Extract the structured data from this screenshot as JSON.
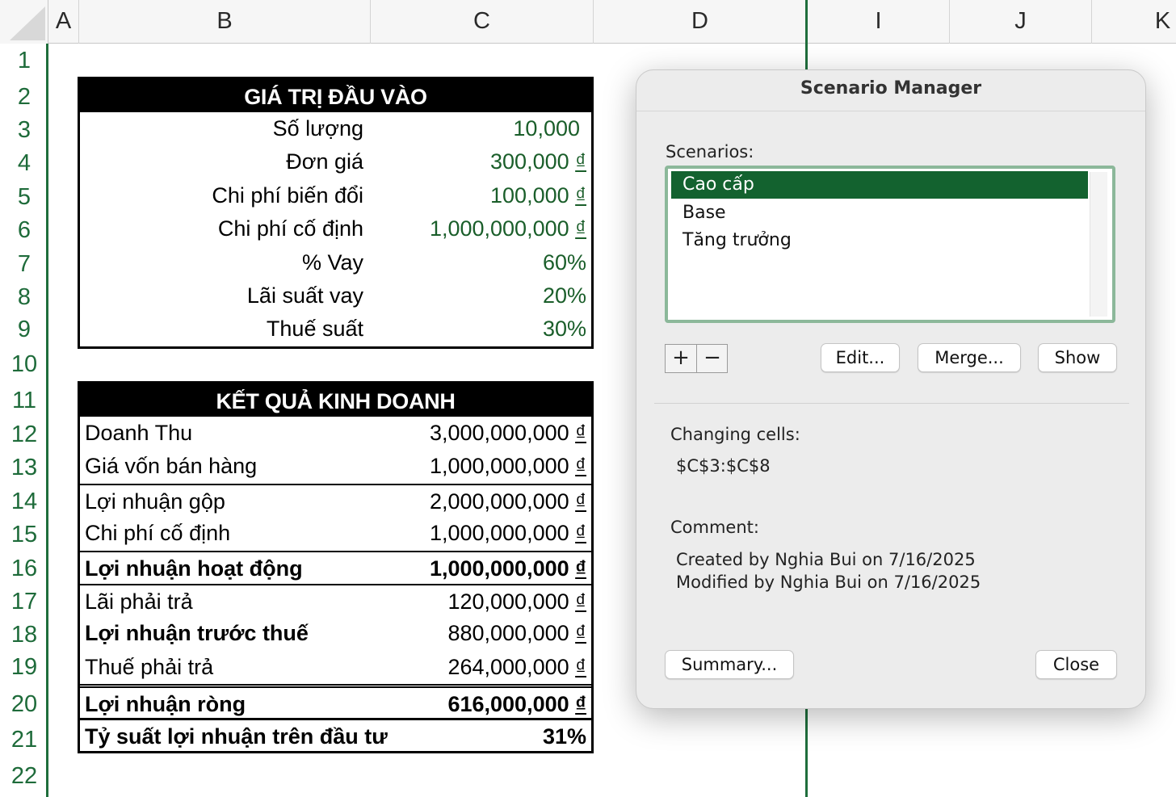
{
  "columns": [
    "A",
    "B",
    "C",
    "D",
    "I",
    "J",
    "K"
  ],
  "rows": [
    "1",
    "2",
    "3",
    "4",
    "5",
    "6",
    "7",
    "8",
    "9",
    "10",
    "11",
    "12",
    "13",
    "14",
    "15",
    "16",
    "17",
    "18",
    "19",
    "20",
    "21",
    "22"
  ],
  "inputs_table": {
    "title": "GIÁ TRỊ ĐẦU VÀO",
    "rows": [
      {
        "label": "Số lượng",
        "value": "10,000",
        "suffix": ""
      },
      {
        "label": "Đơn giá",
        "value": "300,000",
        "suffix": "₫"
      },
      {
        "label": "Chi phí biến đổi",
        "value": "100,000",
        "suffix": "₫"
      },
      {
        "label": "Chi phí cố định",
        "value": "1,000,000,000",
        "suffix": "₫"
      },
      {
        "label": "% Vay",
        "value": "60%",
        "suffix": ""
      },
      {
        "label": "Lãi suất vay",
        "value": "20%",
        "suffix": ""
      },
      {
        "label": "Thuế suất",
        "value": "30%",
        "suffix": ""
      }
    ]
  },
  "results_table": {
    "title": "KẾT QUẢ KINH DOANH",
    "rows": [
      {
        "label": "Doanh Thu",
        "value": "3,000,000,000",
        "suffix": "₫"
      },
      {
        "label": "Giá vốn bán hàng",
        "value": "1,000,000,000",
        "suffix": "₫"
      },
      {
        "label": "Lợi nhuận gộp",
        "value": "2,000,000,000",
        "suffix": "₫"
      },
      {
        "label": "Chi phí cố định",
        "value": "1,000,000,000",
        "suffix": "₫"
      },
      {
        "label": "Lợi nhuận hoạt động",
        "value": "1,000,000,000",
        "suffix": "₫"
      },
      {
        "label": "Lãi phải trả",
        "value": "120,000,000",
        "suffix": "₫"
      },
      {
        "label": "Lợi nhuận trước thuế",
        "value": "880,000,000",
        "suffix": "₫"
      },
      {
        "label": "Thuế phải trả",
        "value": "264,000,000",
        "suffix": "₫"
      },
      {
        "label": "Lợi nhuận ròng",
        "value": "616,000,000",
        "suffix": "₫"
      },
      {
        "label": "Tỷ suất lợi nhuận trên đầu tư",
        "value": "31%",
        "suffix": ""
      }
    ]
  },
  "dialog": {
    "title": "Scenario Manager",
    "scenarios_label": "Scenarios:",
    "scenarios": [
      "Cao cấp",
      "Base",
      "Tăng trưởng"
    ],
    "selected_scenario": "Cao cấp",
    "add_symbol": "+",
    "remove_symbol": "−",
    "edit_button": "Edit...",
    "merge_button": "Merge...",
    "show_button": "Show",
    "changing_cells_label": "Changing cells:",
    "changing_cells_value": "$C$3:$C$8",
    "comment_label": "Comment:",
    "comment_line1": "Created by Nghia Bui on 7/16/2025",
    "comment_line2": "Modified by Nghia Bui on 7/16/2025",
    "summary_button": "Summary...",
    "close_button": "Close"
  },
  "colors": {
    "accent_green": "#13622f",
    "value_green": "#1a5e2a",
    "gridline_green": "#1f6e3c"
  }
}
